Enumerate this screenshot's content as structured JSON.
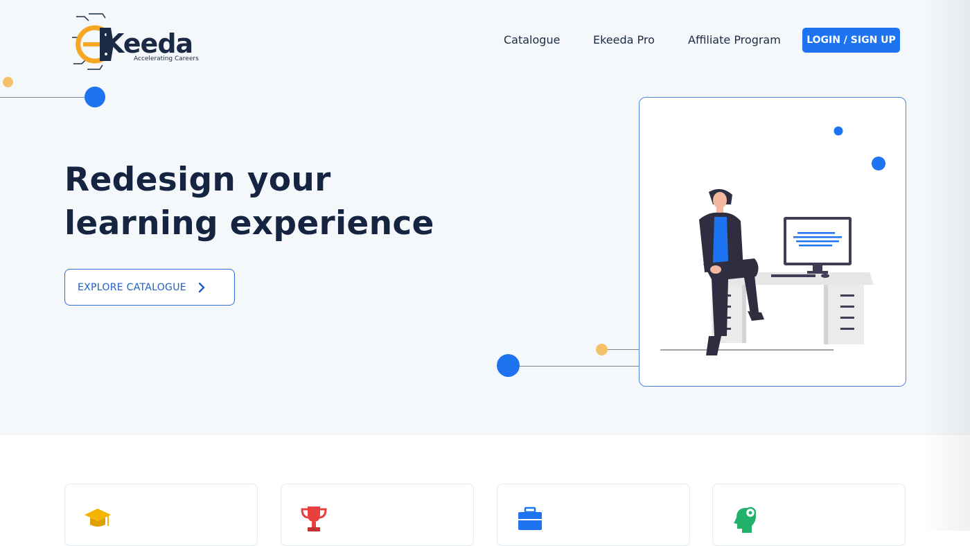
{
  "logo": {
    "text": "Keeda",
    "tagline": "Accelerating Careers"
  },
  "nav": {
    "links": [
      "Catalogue",
      "Ekeeda Pro",
      "Affiliate Program"
    ],
    "login_label": "LOGIN / SIGN UP"
  },
  "hero": {
    "headline_line1": "Redesign your",
    "headline_line2": "learning experience",
    "cta_label": "EXPLORE CATALOGUE"
  },
  "features": [
    {
      "icon": "graduation-cap-icon",
      "color": "#f5b400"
    },
    {
      "icon": "trophy-icon",
      "color": "#e8403f"
    },
    {
      "icon": "briefcase-icon",
      "color": "#1e74f0"
    },
    {
      "icon": "head-gear-icon",
      "color": "#20b26b"
    }
  ],
  "colors": {
    "accent": "#1e74f0",
    "heading": "#152541",
    "dot_yellow": "#f5c26b",
    "hero_bg": "#f5f8fb"
  }
}
